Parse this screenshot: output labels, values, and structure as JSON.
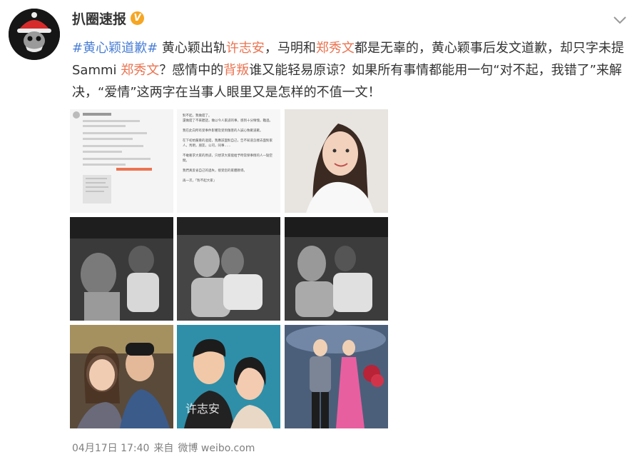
{
  "account": {
    "name": "扒圈速报",
    "badge": "V"
  },
  "post": {
    "hashtag": "#黄心颖道歉#",
    "t1": " 黄心颖出轨",
    "n1": "许志安",
    "t2": "，马明和",
    "n2": "郑秀文",
    "t3": "都是无辜的，黄心颖事后发文道歉，却只字未提",
    "t4": "Sammi ",
    "n3": "郑秀文",
    "t5": "？感情中的",
    "n4": "背叛",
    "t6": "谁又能轻易原谅？如果所有事情都能用一句“对不起，我错了”来解",
    "t7": "决，“爱情”这两字在当事人眼里又是怎样的不值一文！"
  },
  "images": {
    "note_text": [
      "對不起，我做錯了。",
      "還做錯了不來聽話，做以今人家諒的事，感到十分慚愧，難過。",
      "我在此向所有受事件影響及受到傷害的人誠心致歉道歉。",
      "在下初始嚴重的過錯，我應該面對自己，告不知道怎樣去面對家人，馬明，朋友，公司，同事……",
      "不敢奢求大家的原諒，只想求大家能給予時常保事情的人一點空間。",
      "我們真反省自己的過失，接受您的家體教導。",
      "再一次，「對不起大家」"
    ],
    "caption": "许志安"
  },
  "footer": {
    "date": "04月17日 17:40",
    "from": "来自",
    "source": "微博 weibo.com"
  }
}
